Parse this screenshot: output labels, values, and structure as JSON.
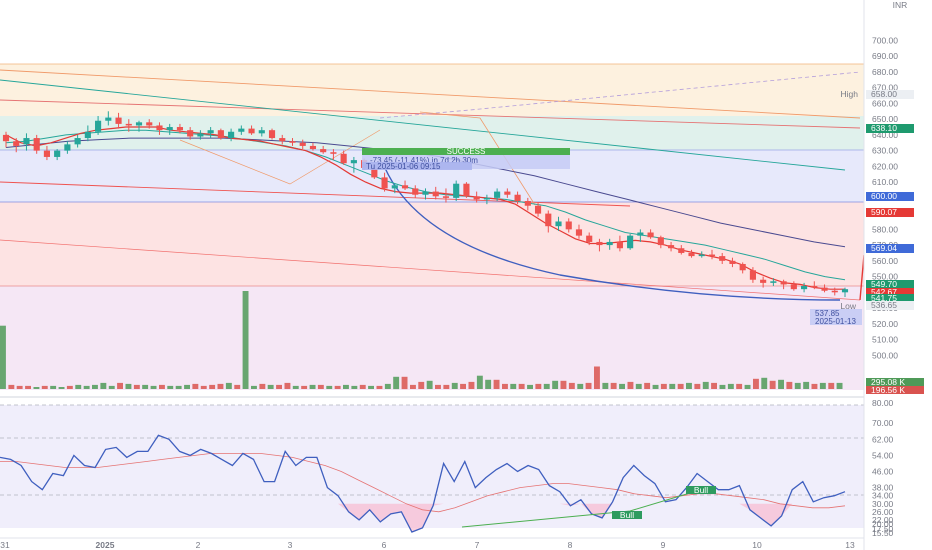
{
  "currency": "INR",
  "price_axis": {
    "ticks": [
      "700.00",
      "690.00",
      "680.00",
      "670.00",
      "660.00",
      "650.00",
      "640.00",
      "630.00",
      "620.00",
      "610.00",
      "600.00",
      "580.00",
      "570.00",
      "560.00",
      "550.00",
      "540.00",
      "530.00",
      "520.00",
      "510.00",
      "500.00"
    ]
  },
  "rsi_axis": {
    "ticks": [
      "80.00",
      "70.00",
      "62.00",
      "54.00",
      "46.00",
      "38.00",
      "34.00",
      "30.00",
      "26.00",
      "22.00",
      "20.00",
      "17.50",
      "15.50"
    ]
  },
  "time_axis": {
    "labels": [
      "31",
      "2025",
      "2",
      "3",
      "6",
      "7",
      "8",
      "9",
      "10",
      "13"
    ]
  },
  "price_tags": {
    "high_label": "High",
    "high": "658.00",
    "level_638": "638.10",
    "level_600": "600.00",
    "ema_590": "590.07",
    "ema_569": "569.04",
    "level_549": "549.70",
    "level_542": "542.67",
    "level_541": "541.75",
    "low_label": "Low",
    "low": "536.65",
    "volume_1": "295.08 K",
    "volume_2": "196.56 K"
  },
  "annotations": {
    "success_label": "SUCCESS",
    "move_text": "-73.45 (-11.41%) in 7d 2h 30m",
    "move_date": "Tu 2025-01-06 09:15",
    "low_info_value": "537.85",
    "low_info_date": "2025-01-13",
    "bull_label_1": "Bull",
    "bull_label_2": "Bull"
  },
  "colors": {
    "up": "#26a69a",
    "down": "#ef5350",
    "up_vol": "#4f9a58",
    "down_vol": "#d9534f",
    "rsi": "#3f5fbf",
    "rsi_ma": "#e57373",
    "ema_fast": "#e53935",
    "ema_mid": "#26a69a",
    "ema_slow": "#4a4a90",
    "blue_tag": "#3f6ad8",
    "red_tag": "#e53935",
    "green_tag": "#1e9a6e"
  },
  "chart_data": [
    {
      "type": "candlestick",
      "yunit": "INR",
      "ylim": [
        497,
        713
      ],
      "candles": [
        [
          640,
          642,
          632,
          636
        ],
        [
          636,
          638,
          629,
          633
        ],
        [
          634,
          641,
          630,
          638
        ],
        [
          638,
          640,
          628,
          630
        ],
        [
          630,
          633,
          624,
          626
        ],
        [
          626,
          631,
          624,
          630
        ],
        [
          630,
          636,
          628,
          634
        ],
        [
          634,
          640,
          632,
          638
        ],
        [
          638,
          646,
          636,
          642
        ],
        [
          642,
          652,
          640,
          649
        ],
        [
          649,
          655,
          646,
          651
        ],
        [
          651,
          654,
          644,
          647
        ],
        [
          647,
          650,
          642,
          646
        ],
        [
          646,
          649,
          642,
          648
        ],
        [
          648,
          650,
          644,
          646
        ],
        [
          646,
          648,
          640,
          643
        ],
        [
          643,
          647,
          640,
          645
        ],
        [
          645,
          647,
          641,
          643
        ],
        [
          643,
          645,
          637,
          639
        ],
        [
          639,
          643,
          637,
          641
        ],
        [
          641,
          645,
          638,
          643
        ],
        [
          643,
          644,
          637,
          638
        ],
        [
          638,
          644,
          636,
          642
        ],
        [
          642,
          646,
          640,
          644
        ],
        [
          644,
          646,
          640,
          641
        ],
        [
          641,
          645,
          639,
          643
        ],
        [
          643,
          644,
          637,
          638
        ],
        [
          638,
          640,
          634,
          636
        ],
        [
          636,
          638,
          633,
          635
        ],
        [
          635,
          637,
          631,
          633
        ],
        [
          633,
          635,
          630,
          631
        ],
        [
          631,
          633,
          628,
          629
        ],
        [
          629,
          631,
          624,
          628
        ],
        [
          628,
          630,
          621,
          622
        ],
        [
          622,
          626,
          616,
          624
        ],
        [
          624,
          625,
          618,
          619
        ],
        [
          619,
          621,
          612,
          613
        ],
        [
          613,
          616,
          604,
          606
        ],
        [
          606,
          609,
          603,
          608
        ],
        [
          608,
          611,
          605,
          606
        ],
        [
          606,
          608,
          600,
          602
        ],
        [
          602,
          606,
          599,
          604
        ],
        [
          604,
          607,
          599,
          601
        ],
        [
          601,
          606,
          597,
          600
        ],
        [
          600,
          611,
          598,
          609
        ],
        [
          609,
          610,
          600,
          601
        ],
        [
          601,
          604,
          597,
          599
        ],
        [
          599,
          602,
          596,
          600
        ],
        [
          600,
          606,
          598,
          604
        ],
        [
          604,
          606,
          600,
          602
        ],
        [
          602,
          604,
          596,
          598
        ],
        [
          598,
          600,
          592,
          595
        ],
        [
          595,
          597,
          588,
          590
        ],
        [
          590,
          592,
          578,
          582
        ],
        [
          582,
          588,
          579,
          585
        ],
        [
          585,
          587,
          578,
          580
        ],
        [
          580,
          583,
          574,
          576
        ],
        [
          576,
          578,
          570,
          572
        ],
        [
          572,
          574,
          566,
          570
        ],
        [
          570,
          574,
          567,
          572
        ],
        [
          572,
          576,
          566,
          568
        ],
        [
          568,
          577,
          567,
          576
        ],
        [
          576,
          580,
          572,
          578
        ],
        [
          578,
          580,
          574,
          575
        ],
        [
          575,
          576,
          568,
          570
        ],
        [
          570,
          572,
          566,
          568
        ],
        [
          568,
          570,
          564,
          565
        ],
        [
          565,
          567,
          562,
          563
        ],
        [
          563,
          566,
          562,
          564
        ],
        [
          564,
          567,
          561,
          563
        ],
        [
          563,
          565,
          558,
          560
        ],
        [
          560,
          562,
          556,
          558
        ],
        [
          558,
          559,
          552,
          554
        ],
        [
          554,
          556,
          546,
          548
        ],
        [
          548,
          550,
          543,
          546
        ],
        [
          546,
          549,
          544,
          547
        ],
        [
          547,
          548,
          542,
          545
        ],
        [
          545,
          547,
          541,
          542
        ],
        [
          542,
          546,
          540,
          544
        ],
        [
          544,
          547,
          542,
          543
        ],
        [
          543,
          545,
          540,
          541
        ],
        [
          541,
          543,
          538,
          540
        ],
        [
          540,
          543,
          537,
          542
        ]
      ],
      "ema_fast": [
        640,
        635,
        633,
        635,
        638,
        641,
        643,
        644,
        645,
        645,
        645,
        643,
        642,
        641,
        640,
        638,
        637,
        636,
        634,
        632,
        630,
        626,
        621,
        615,
        610,
        606,
        604,
        603,
        603,
        603,
        602,
        601,
        600,
        599,
        596,
        590,
        584,
        579,
        574,
        571,
        571,
        572,
        573,
        572,
        570,
        567,
        565,
        563,
        561,
        558,
        553,
        549,
        546,
        545,
        543,
        542,
        542
      ],
      "ema_mid": [
        635,
        636,
        638,
        640,
        641,
        642,
        643,
        643,
        642,
        641,
        640,
        639,
        637,
        635,
        633,
        630,
        626,
        621,
        616,
        611,
        607,
        604,
        602,
        601,
        600,
        599,
        597,
        595,
        591,
        586,
        582,
        578,
        576,
        574,
        572,
        570,
        567,
        564,
        561,
        557,
        553,
        550,
        548
      ],
      "ema_slow": [
        632,
        634,
        636,
        637,
        638,
        638,
        638,
        638,
        637,
        636,
        635,
        633,
        631,
        629,
        626,
        622,
        618,
        614,
        609,
        604,
        599,
        594,
        589,
        584,
        580,
        576,
        572,
        569
      ],
      "volume": [
        [
          "u",
          62
        ],
        [
          "d",
          4
        ],
        [
          "d",
          3
        ],
        [
          "d",
          3
        ],
        [
          "u",
          2
        ],
        [
          "d",
          3
        ],
        [
          "u",
          3
        ],
        [
          "u",
          2
        ],
        [
          "d",
          3
        ],
        [
          "u",
          4
        ],
        [
          "u",
          3
        ],
        [
          "u",
          4
        ],
        [
          "u",
          6
        ],
        [
          "u",
          3
        ],
        [
          "d",
          6
        ],
        [
          "u",
          5
        ],
        [
          "d",
          4
        ],
        [
          "u",
          4
        ],
        [
          "u",
          3
        ],
        [
          "d",
          4
        ],
        [
          "u",
          3
        ],
        [
          "u",
          3
        ],
        [
          "u",
          4
        ],
        [
          "d",
          5
        ],
        [
          "d",
          3
        ],
        [
          "d",
          4
        ],
        [
          "d",
          5
        ],
        [
          "u",
          6
        ],
        [
          "d",
          4
        ],
        [
          "u",
          96
        ],
        [
          "u",
          3
        ],
        [
          "d",
          5
        ],
        [
          "u",
          4
        ],
        [
          "d",
          4
        ],
        [
          "d",
          6
        ],
        [
          "u",
          3
        ],
        [
          "d",
          3
        ],
        [
          "u",
          4
        ],
        [
          "d",
          4
        ],
        [
          "u",
          3
        ],
        [
          "d",
          3
        ],
        [
          "u",
          4
        ],
        [
          "u",
          3
        ],
        [
          "d",
          4
        ],
        [
          "u",
          3
        ],
        [
          "d",
          3
        ],
        [
          "u",
          5
        ],
        [
          "u",
          12
        ],
        [
          "d",
          12
        ],
        [
          "d",
          4
        ],
        [
          "d",
          7
        ],
        [
          "u",
          8
        ],
        [
          "d",
          4
        ],
        [
          "d",
          4
        ],
        [
          "u",
          6
        ],
        [
          "d",
          5
        ],
        [
          "d",
          7
        ],
        [
          "u",
          13
        ],
        [
          "u",
          9
        ],
        [
          "d",
          9
        ],
        [
          "d",
          5
        ],
        [
          "u",
          5
        ],
        [
          "d",
          5
        ],
        [
          "u",
          4
        ],
        [
          "d",
          5
        ],
        [
          "u",
          5
        ],
        [
          "u",
          8
        ],
        [
          "d",
          8
        ],
        [
          "d",
          6
        ],
        [
          "u",
          5
        ],
        [
          "d",
          6
        ],
        [
          "d",
          22
        ],
        [
          "u",
          6
        ],
        [
          "d",
          6
        ],
        [
          "u",
          5
        ],
        [
          "d",
          7
        ],
        [
          "u",
          5
        ],
        [
          "d",
          6
        ],
        [
          "u",
          4
        ],
        [
          "d",
          5
        ],
        [
          "u",
          5
        ],
        [
          "d",
          5
        ],
        [
          "u",
          6
        ],
        [
          "d",
          5
        ],
        [
          "u",
          7
        ],
        [
          "d",
          6
        ],
        [
          "u",
          4
        ],
        [
          "u",
          5
        ],
        [
          "d",
          5
        ],
        [
          "u",
          4
        ],
        [
          "d",
          10
        ],
        [
          "u",
          11
        ],
        [
          "d",
          8
        ],
        [
          "u",
          9
        ],
        [
          "d",
          7
        ],
        [
          "u",
          6
        ],
        [
          "u",
          7
        ],
        [
          "d",
          5
        ],
        [
          "u",
          6
        ],
        [
          "d",
          6
        ],
        [
          "u",
          6
        ]
      ],
      "volume_max": 96
    },
    {
      "type": "line",
      "name": "RSI",
      "ylim": [
        14,
        82
      ],
      "rsi": [
        53,
        52,
        49,
        41,
        37,
        45,
        44,
        54,
        49,
        48,
        57,
        58,
        53,
        56,
        56,
        64,
        62,
        56,
        54,
        57,
        55,
        52,
        49,
        55,
        52,
        41,
        41,
        56,
        49,
        53,
        53,
        38,
        34,
        26,
        22,
        27,
        21,
        25,
        26,
        16,
        18,
        29,
        50,
        41,
        51,
        38,
        43,
        47,
        50,
        46,
        49,
        47,
        39,
        36,
        29,
        32,
        25,
        23,
        31,
        43,
        49,
        44,
        40,
        31,
        32,
        38,
        45,
        41,
        37,
        37,
        39,
        27,
        23,
        19,
        24,
        37,
        41,
        31,
        33,
        34,
        36
      ],
      "rsi_ma": [
        51,
        51,
        50,
        49,
        48,
        48,
        48,
        49,
        50,
        51,
        52,
        53,
        54,
        55,
        55,
        55,
        55,
        54,
        53,
        51,
        49,
        46,
        42,
        38,
        34,
        30,
        27,
        26,
        28,
        31,
        34,
        36,
        38,
        39,
        40,
        40,
        39,
        38,
        37,
        35,
        34,
        33,
        34,
        35,
        35,
        34,
        33,
        32,
        30,
        29,
        28,
        28,
        29
      ]
    }
  ]
}
